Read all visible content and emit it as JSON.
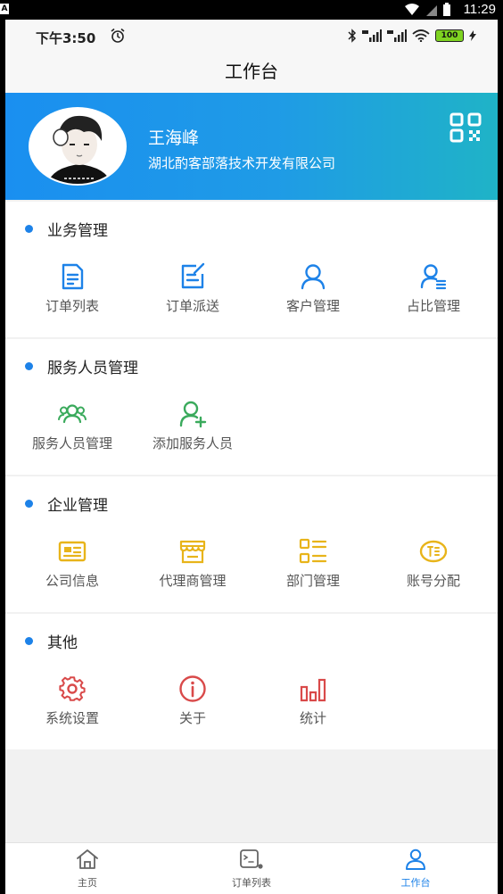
{
  "system_bar": {
    "badge": "A",
    "time": "11:29"
  },
  "status_bar": {
    "time": "下午3:50",
    "battery": "100"
  },
  "header": {
    "title": "工作台"
  },
  "profile": {
    "name": "王海峰",
    "company": "湖北酌客部落技术开发有限公司"
  },
  "sections": [
    {
      "title": "业务管理",
      "items": [
        {
          "label": "订单列表",
          "icon": "order-list-icon",
          "color": "#1d82e8"
        },
        {
          "label": "订单派送",
          "icon": "order-dispatch-icon",
          "color": "#1d82e8"
        },
        {
          "label": "客户管理",
          "icon": "customer-icon",
          "color": "#1d82e8"
        },
        {
          "label": "占比管理",
          "icon": "ratio-icon",
          "color": "#1d82e8"
        }
      ]
    },
    {
      "title": "服务人员管理",
      "items": [
        {
          "label": "服务人员管理",
          "icon": "staff-group-icon",
          "color": "#3aaa5c"
        },
        {
          "label": "添加服务人员",
          "icon": "add-staff-icon",
          "color": "#3aaa5c"
        }
      ]
    },
    {
      "title": "企业管理",
      "items": [
        {
          "label": "公司信息",
          "icon": "company-card-icon",
          "color": "#e8b41a"
        },
        {
          "label": "代理商管理",
          "icon": "agent-store-icon",
          "color": "#e8b41a"
        },
        {
          "label": "部门管理",
          "icon": "department-icon",
          "color": "#e8b41a"
        },
        {
          "label": "账号分配",
          "icon": "account-icon",
          "color": "#e8b41a"
        }
      ]
    },
    {
      "title": "其他",
      "items": [
        {
          "label": "系统设置",
          "icon": "gear-icon",
          "color": "#d94a4a"
        },
        {
          "label": "关于",
          "icon": "info-icon",
          "color": "#d94a4a"
        },
        {
          "label": "统计",
          "icon": "stats-icon",
          "color": "#d94a4a"
        }
      ]
    }
  ],
  "bottom_nav": [
    {
      "label": "主页",
      "icon": "home-icon"
    },
    {
      "label": "订单列表",
      "icon": "order-tab-icon"
    },
    {
      "label": "工作台",
      "icon": "user-tab-icon",
      "active": true
    }
  ],
  "colors": {
    "accent": "#1d82e8",
    "green": "#3aaa5c",
    "yellow": "#e8b41a",
    "red": "#d94a4a"
  }
}
